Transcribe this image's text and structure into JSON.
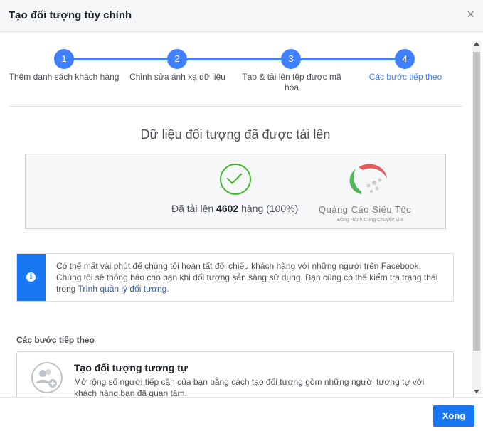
{
  "dialog": {
    "title": "Tạo đối tượng tùy chỉnh",
    "close_icon": "×"
  },
  "steps": [
    {
      "number": "1",
      "label": "Thêm danh sách khách hàng"
    },
    {
      "number": "2",
      "label": "Chỉnh sửa ánh xạ dữ liệu"
    },
    {
      "number": "3",
      "label": "Tạo & tải lên tệp được mã hóa"
    },
    {
      "number": "4",
      "label": "Các bước tiếp theo"
    }
  ],
  "main": {
    "title": "Dữ liệu đối tượng đã được tải lên",
    "upload_prefix": "Đã tải lên",
    "upload_count": "4602",
    "upload_suffix": "hàng (100%)"
  },
  "logo": {
    "name": "Quảng Cáo Siêu Tốc",
    "tagline": "Đồng Hành Cùng Chuyên Gia"
  },
  "info": {
    "icon": "i",
    "text_before_link": "Có thể mất vài phút để chúng tôi hoàn tất đối chiếu khách hàng với những người trên Facebook. Chúng tôi sẽ thông báo cho bạn khi đối tượng sẵn sàng sử dụng. Bạn cũng có thể kiểm tra trạng thái trong ",
    "link": "Trình quản lý đối tượng",
    "text_after_link": "."
  },
  "next_steps": {
    "title": "Các bước tiếp theo",
    "option_title": "Tạo đối tượng tương tự",
    "option_desc": "Mở rộng số người tiếp cận của bạn bằng cách tạo đối tượng gồm những người tương tự với khách hàng bạn đã quan tâm."
  },
  "footer": {
    "done_label": "Xong"
  },
  "colors": {
    "accent": "#4080ff",
    "button": "#1877f2",
    "success": "#42b72a"
  }
}
